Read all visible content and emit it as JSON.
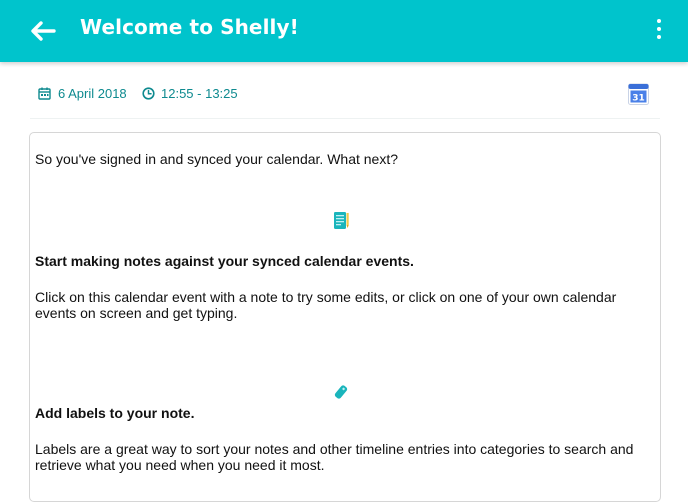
{
  "header": {
    "title": "Welcome to Shelly!",
    "back_icon": "arrow-left-icon",
    "menu_icon": "more-vertical-icon",
    "background_color": "#00c4cc"
  },
  "event": {
    "date": "6 April 2018",
    "time_range": "12:55 - 13:25",
    "date_icon": "calendar-icon",
    "time_icon": "clock-icon",
    "calendar_badge": "31",
    "calendar_app_icon": "google-calendar-icon",
    "accent_color": "#0e8a8f"
  },
  "note": {
    "intro": "So you've signed in and synced your calendar. What next?",
    "section1_icon": "notes-icon",
    "section1_heading": "Start making notes against your synced calendar events.",
    "section1_body": "Click on this calendar event with a note to try some edits, or click on one of your own calendar events on screen and get typing.",
    "section2_icon": "label-icon",
    "section2_heading": "Add labels to your note.",
    "section2_body": "Labels are a great way to sort your notes and other timeline entries into categories to search and retrieve what you need when you need it most."
  }
}
